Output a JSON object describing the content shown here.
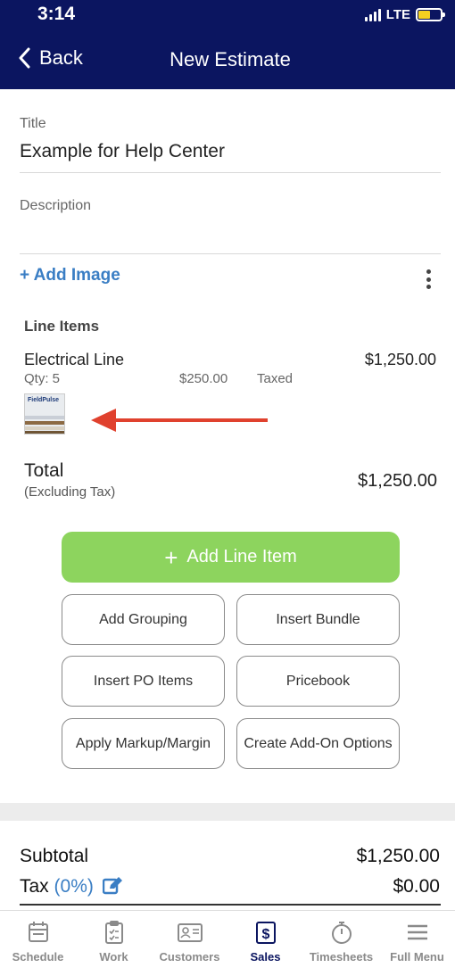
{
  "status": {
    "time": "3:14",
    "network": "LTE",
    "battery_level": 0.55
  },
  "nav": {
    "back_label": "Back",
    "title": "New Estimate"
  },
  "form": {
    "title_label": "Title",
    "title_value": "Example for Help Center",
    "description_label": "Description",
    "description_value": "",
    "add_image_label": "+ Add Image"
  },
  "line_items": {
    "heading": "Line Items",
    "items": [
      {
        "name": "Electrical Line",
        "qty": "Qty: 5",
        "unit_price": "$250.00",
        "tax_status": "Taxed",
        "total": "$1,250.00",
        "thumbnail_text": "FieldPulse"
      }
    ]
  },
  "total": {
    "label": "Total",
    "sublabel": "(Excluding Tax)",
    "value": "$1,250.00"
  },
  "actions": {
    "add_line_item": "Add Line Item",
    "add_grouping": "Add Grouping",
    "insert_bundle": "Insert Bundle",
    "insert_po_items": "Insert PO Items",
    "pricebook": "Pricebook",
    "apply_markup": "Apply Markup/Margin",
    "create_addon": "Create Add-On Options"
  },
  "summary": {
    "subtotal_label": "Subtotal",
    "subtotal_value": "$1,250.00",
    "tax_label": "Tax",
    "tax_percent": "(0%)",
    "tax_value": "$0.00"
  },
  "tabs": [
    {
      "label": "Schedule",
      "icon": "calendar-icon",
      "active": false
    },
    {
      "label": "Work",
      "icon": "clipboard-icon",
      "active": false
    },
    {
      "label": "Customers",
      "icon": "contact-card-icon",
      "active": false
    },
    {
      "label": "Sales",
      "icon": "dollar-doc-icon",
      "active": true
    },
    {
      "label": "Timesheets",
      "icon": "stopwatch-icon",
      "active": false
    },
    {
      "label": "Full Menu",
      "icon": "hamburger-icon",
      "active": false
    }
  ],
  "colors": {
    "header_bg": "#0b1560",
    "link_blue": "#3a7ec4",
    "primary_green": "#8dd45e",
    "annotation_arrow": "#e0412e",
    "battery_yellow": "#f5d120"
  }
}
